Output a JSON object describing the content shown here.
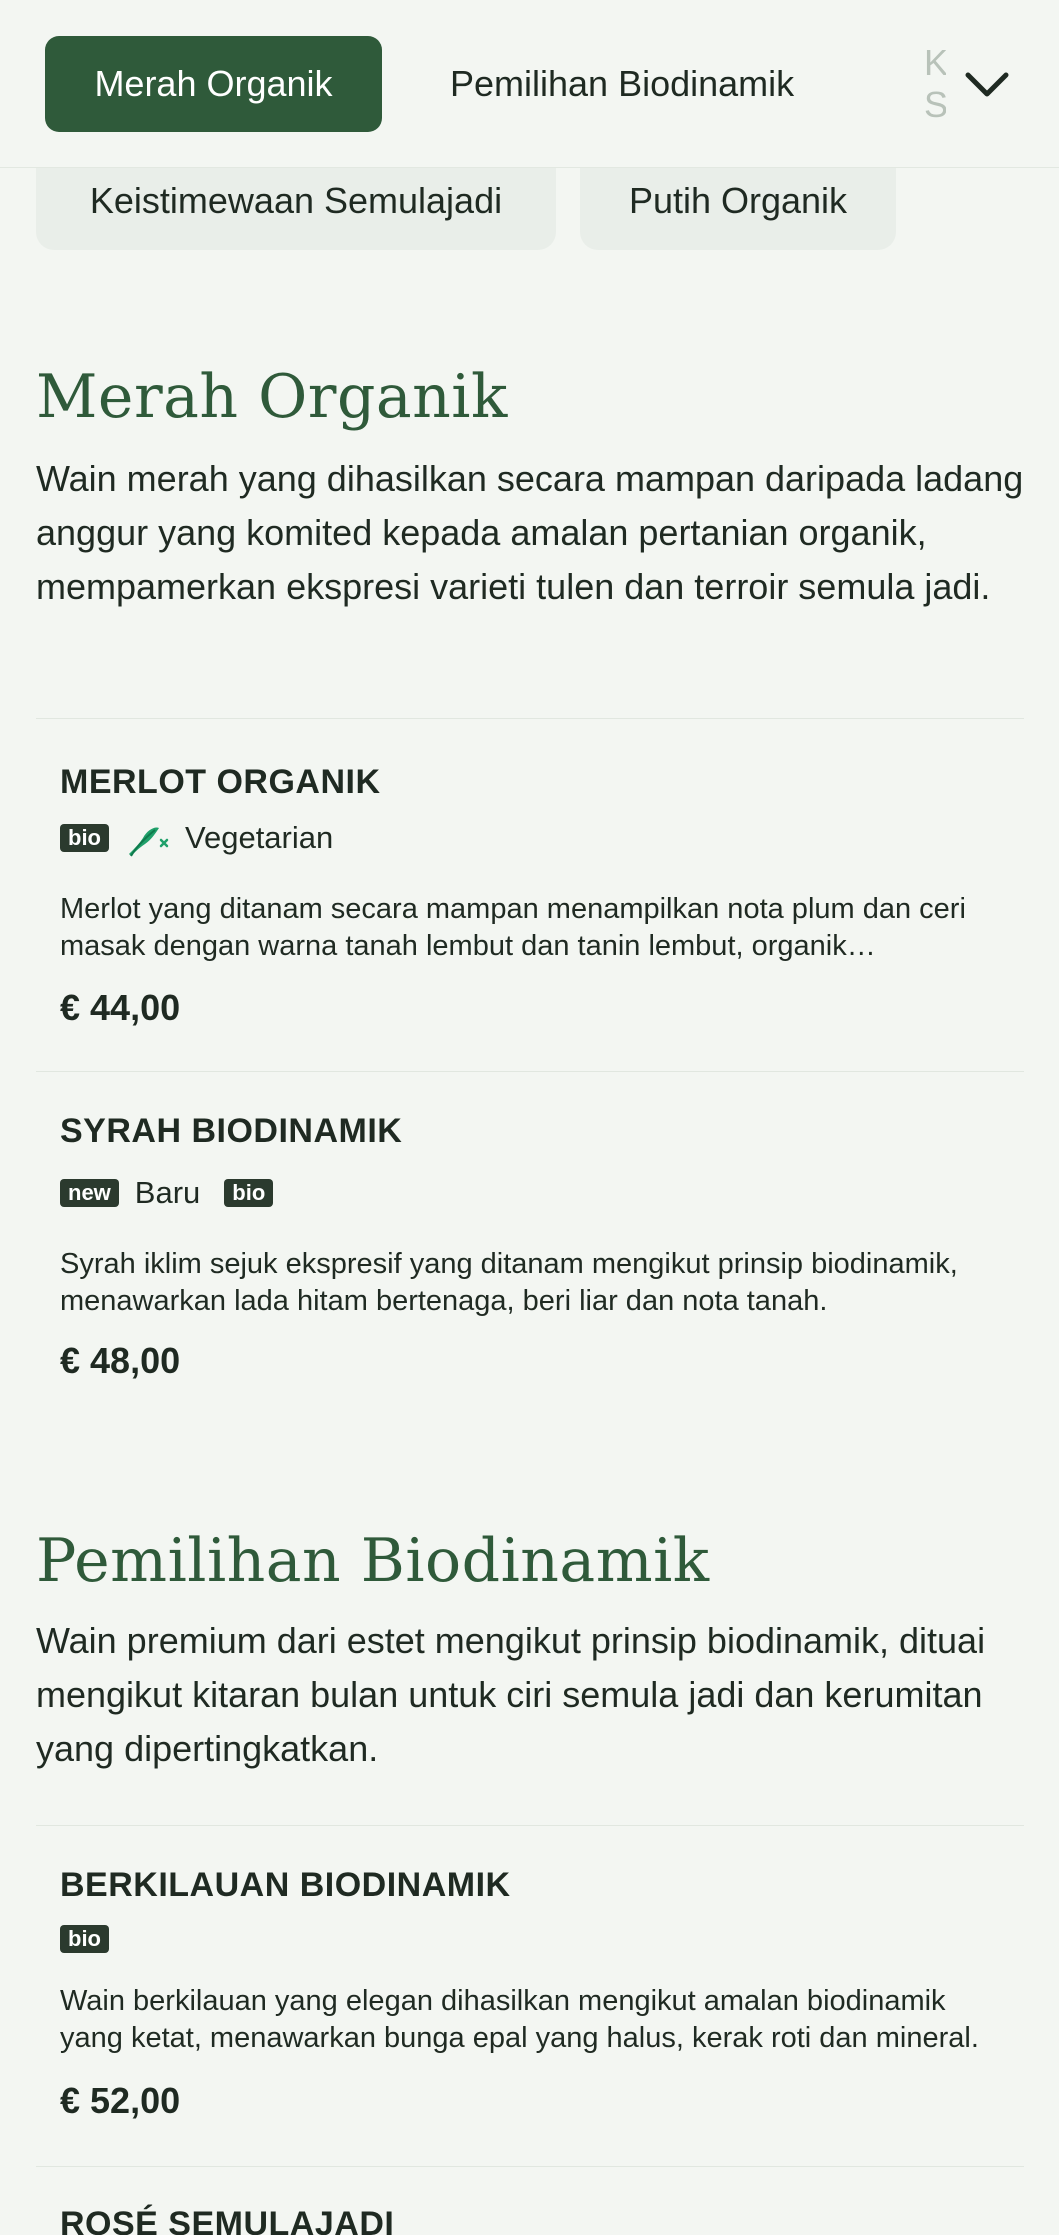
{
  "nav": {
    "tabs": [
      {
        "label": "Merah Organik"
      },
      {
        "label": "Pemilihan Biodinamik"
      },
      {
        "label": "Keistimewaan Semulajadi"
      }
    ],
    "pills": [
      {
        "label": "Keistimewaan Semulajadi"
      },
      {
        "label": "Putih Organik"
      }
    ]
  },
  "sections": [
    {
      "title": "Merah Organik",
      "description": "Wain merah yang dihasilkan secara mampan daripada ladang anggur yang komited kepada amalan pertanian organik, mempamerkan ekspresi varieti tulen dan terroir semula jadi.",
      "items": [
        {
          "name": "MERLOT ORGANIK",
          "badges": [
            "bio"
          ],
          "tag_label": "Vegetarian",
          "description": "Merlot yang ditanam secara mampan menampilkan nota plum dan ceri masak dengan warna tanah lembut dan tanin lembut, organik sepenuhnya.",
          "price": "€ 44,00"
        },
        {
          "name": "SYRAH BIODINAMIK",
          "new_badge": "new",
          "new_label": "Baru",
          "badges": [
            "bio"
          ],
          "description": "Syrah iklim sejuk ekspresif yang ditanam mengikut prinsip biodinamik, menawarkan lada hitam bertenaga, beri liar dan nota tanah.",
          "price": "€ 48,00"
        }
      ]
    },
    {
      "title": "Pemilihan Biodinamik",
      "description": "Wain premium dari estet mengikut prinsip biodinamik, dituai mengikut kitaran bulan untuk ciri semula jadi dan kerumitan yang dipertingkatkan.",
      "items": [
        {
          "name": "BERKILAUAN BIODINAMIK",
          "badges": [
            "bio"
          ],
          "description": "Wain berkilauan yang elegan dihasilkan mengikut amalan biodinamik yang ketat, menawarkan bunga epal yang halus, kerak roti dan mineral.",
          "price": "€ 52,00"
        },
        {
          "name": "ROSÉ SEMULAJADI"
        }
      ]
    }
  ],
  "colors": {
    "accent": "#2f5a3a",
    "background": "#f3f6f2",
    "badge": "#2b3a2e",
    "leaf": "#1fa06a"
  }
}
